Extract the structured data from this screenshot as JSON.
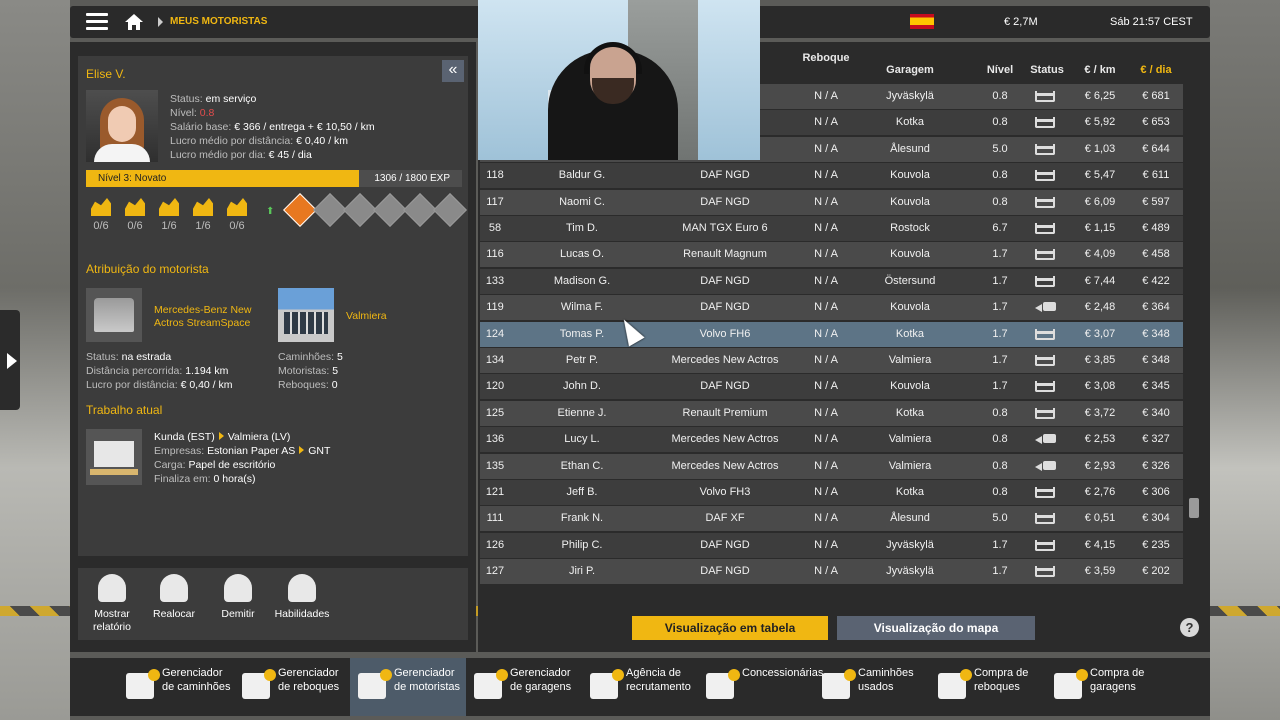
{
  "topbar": {
    "breadcrumb": "MEUS MOTORISTAS",
    "money": "€ 2,7M",
    "datetime": "Sáb 21:57 CEST"
  },
  "driver": {
    "name": "Elise V.",
    "status_label": "Status:",
    "status_value": "em serviço",
    "level_label": "Nível:",
    "level_value": "0.8",
    "salary_label": "Salário base:",
    "salary_value": "€ 366 / entrega + € 10,50 / km",
    "profit_km_label": "Lucro médio por distância:",
    "profit_km_value": "€ 0,40 / km",
    "profit_day_label": "Lucro médio por dia:",
    "profit_day_value": "€ 45 / dia",
    "level_bar_label": "Nível 3: Novato",
    "exp": "1306 / 1800 EXP",
    "exp_fraction": 0.7256,
    "skills": [
      "0/6",
      "0/6",
      "1/6",
      "1/6",
      "0/6"
    ]
  },
  "assignment": {
    "title": "Atribuição do motorista",
    "truck_name": "Mercedes-Benz New Actros StreamSpace",
    "garage_name": "Valmiera",
    "status_label": "Status:",
    "status_value": "na estrada",
    "distance_label": "Distância percorrida:",
    "distance_value": "1.194 km",
    "profit_label": "Lucro por distância:",
    "profit_value": "€ 0,40 / km",
    "trucks_label": "Caminhões:",
    "trucks_value": "5",
    "drivers_label": "Motoristas:",
    "drivers_value": "5",
    "trailers_label": "Reboques:",
    "trailers_value": "0"
  },
  "job": {
    "title": "Trabalho atual",
    "from": "Kunda (EST)",
    "to": "Valmiera (LV)",
    "companies_label": "Empresas:",
    "companies_from": "Estonian Paper AS",
    "companies_to": "GNT",
    "cargo_label": "Carga:",
    "cargo_value": "Papel de escritório",
    "ends_label": "Finaliza em:",
    "ends_value": "0 hora(s)"
  },
  "actions": {
    "report": "Mostrar relatório",
    "relocate": "Realocar",
    "fire": "Demitir",
    "skills": "Habilidades"
  },
  "table": {
    "headers": {
      "trailer": "Reboque",
      "garage": "Garagem",
      "level": "Nível",
      "status": "Status",
      "per_km": "€ / km",
      "per_day": "€ / dia"
    },
    "rows": [
      {
        "id": "",
        "name": "",
        "truck": "",
        "trailer": "N / A",
        "garage": "Jyväskylä",
        "level": "0.8",
        "status": "bed",
        "km": "€ 6,25",
        "day": "€ 681"
      },
      {
        "id": "",
        "name": "",
        "truck": "m",
        "trailer": "N / A",
        "garage": "Kotka",
        "level": "0.8",
        "status": "bed",
        "km": "€ 5,92",
        "day": "€ 653"
      },
      {
        "id": "",
        "name": "",
        "truck": "tros",
        "trailer": "N / A",
        "garage": "Ålesund",
        "level": "5.0",
        "status": "bed",
        "km": "€ 1,03",
        "day": "€ 644"
      },
      {
        "id": "118",
        "name": "Baldur G.",
        "truck": "DAF NGD",
        "trailer": "N / A",
        "garage": "Kouvola",
        "level": "0.8",
        "status": "bed",
        "km": "€ 5,47",
        "day": "€ 611"
      },
      {
        "id": "117",
        "name": "Naomi C.",
        "truck": "DAF NGD",
        "trailer": "N / A",
        "garage": "Kouvola",
        "level": "0.8",
        "status": "bed",
        "km": "€ 6,09",
        "day": "€ 597"
      },
      {
        "id": "58",
        "name": "Tim D.",
        "truck": "MAN TGX Euro 6",
        "trailer": "N / A",
        "garage": "Rostock",
        "level": "6.7",
        "status": "bed",
        "km": "€ 1,15",
        "day": "€ 489"
      },
      {
        "id": "116",
        "name": "Lucas O.",
        "truck": "Renault Magnum",
        "trailer": "N / A",
        "garage": "Kouvola",
        "level": "1.7",
        "status": "bed",
        "km": "€ 4,09",
        "day": "€ 458"
      },
      {
        "id": "133",
        "name": "Madison G.",
        "truck": "DAF NGD",
        "trailer": "N / A",
        "garage": "Östersund",
        "level": "1.7",
        "status": "bed",
        "km": "€ 7,44",
        "day": "€ 422"
      },
      {
        "id": "119",
        "name": "Wilma F.",
        "truck": "DAF NGD",
        "trailer": "N / A",
        "garage": "Kouvola",
        "level": "1.7",
        "status": "truck",
        "km": "€ 2,48",
        "day": "€ 364"
      },
      {
        "id": "124",
        "name": "Tomas P.",
        "truck": "Volvo FH6",
        "trailer": "N / A",
        "garage": "Kotka",
        "level": "1.7",
        "status": "bed",
        "km": "€ 3,07",
        "day": "€ 348"
      },
      {
        "id": "134",
        "name": "Petr P.",
        "truck": "Mercedes New Actros",
        "trailer": "N / A",
        "garage": "Valmiera",
        "level": "1.7",
        "status": "bed",
        "km": "€ 3,85",
        "day": "€ 348"
      },
      {
        "id": "120",
        "name": "John D.",
        "truck": "DAF NGD",
        "trailer": "N / A",
        "garage": "Kouvola",
        "level": "1.7",
        "status": "bed",
        "km": "€ 3,08",
        "day": "€ 345"
      },
      {
        "id": "125",
        "name": "Etienne J.",
        "truck": "Renault Premium",
        "trailer": "N / A",
        "garage": "Kotka",
        "level": "0.8",
        "status": "bed",
        "km": "€ 3,72",
        "day": "€ 340"
      },
      {
        "id": "136",
        "name": "Lucy L.",
        "truck": "Mercedes New Actros",
        "trailer": "N / A",
        "garage": "Valmiera",
        "level": "0.8",
        "status": "truck",
        "km": "€ 2,53",
        "day": "€ 327"
      },
      {
        "id": "135",
        "name": "Ethan C.",
        "truck": "Mercedes New Actros",
        "trailer": "N / A",
        "garage": "Valmiera",
        "level": "0.8",
        "status": "truck",
        "km": "€ 2,93",
        "day": "€ 326"
      },
      {
        "id": "121",
        "name": "Jeff B.",
        "truck": "Volvo FH3",
        "trailer": "N / A",
        "garage": "Kotka",
        "level": "0.8",
        "status": "bed",
        "km": "€ 2,76",
        "day": "€ 306"
      },
      {
        "id": "111",
        "name": "Frank N.",
        "truck": "DAF XF",
        "trailer": "N / A",
        "garage": "Ålesund",
        "level": "5.0",
        "status": "bed",
        "km": "€ 0,51",
        "day": "€ 304"
      },
      {
        "id": "126",
        "name": "Philip C.",
        "truck": "DAF NGD",
        "trailer": "N / A",
        "garage": "Jyväskylä",
        "level": "1.7",
        "status": "bed",
        "km": "€ 4,15",
        "day": "€ 235"
      },
      {
        "id": "127",
        "name": "Jiri P.",
        "truck": "DAF NGD",
        "trailer": "N / A",
        "garage": "Jyväskylä",
        "level": "1.7",
        "status": "bed",
        "km": "€ 3,59",
        "day": "€ 202"
      }
    ],
    "selected_id": "124"
  },
  "views": {
    "table": "Visualização em tabela",
    "map": "Visualização do mapa",
    "help": "?"
  },
  "bottom": [
    {
      "label": "Gerenciador de caminhões",
      "icon": "truck-manager-icon"
    },
    {
      "label": "Gerenciador de reboques",
      "icon": "trailer-manager-icon"
    },
    {
      "label": "Gerenciador de motoristas",
      "icon": "driver-manager-icon"
    },
    {
      "label": "Gerenciador de garagens",
      "icon": "garage-manager-icon"
    },
    {
      "label": "Agência de recrutamento",
      "icon": "recruitment-icon"
    },
    {
      "label": "Concessionárias",
      "icon": "dealer-icon"
    },
    {
      "label": "Caminhões usados",
      "icon": "used-trucks-icon"
    },
    {
      "label": "Compra de reboques",
      "icon": "buy-trailers-icon"
    },
    {
      "label": "Compra de garagens",
      "icon": "buy-garages-icon"
    }
  ],
  "bottom_active": 2
}
